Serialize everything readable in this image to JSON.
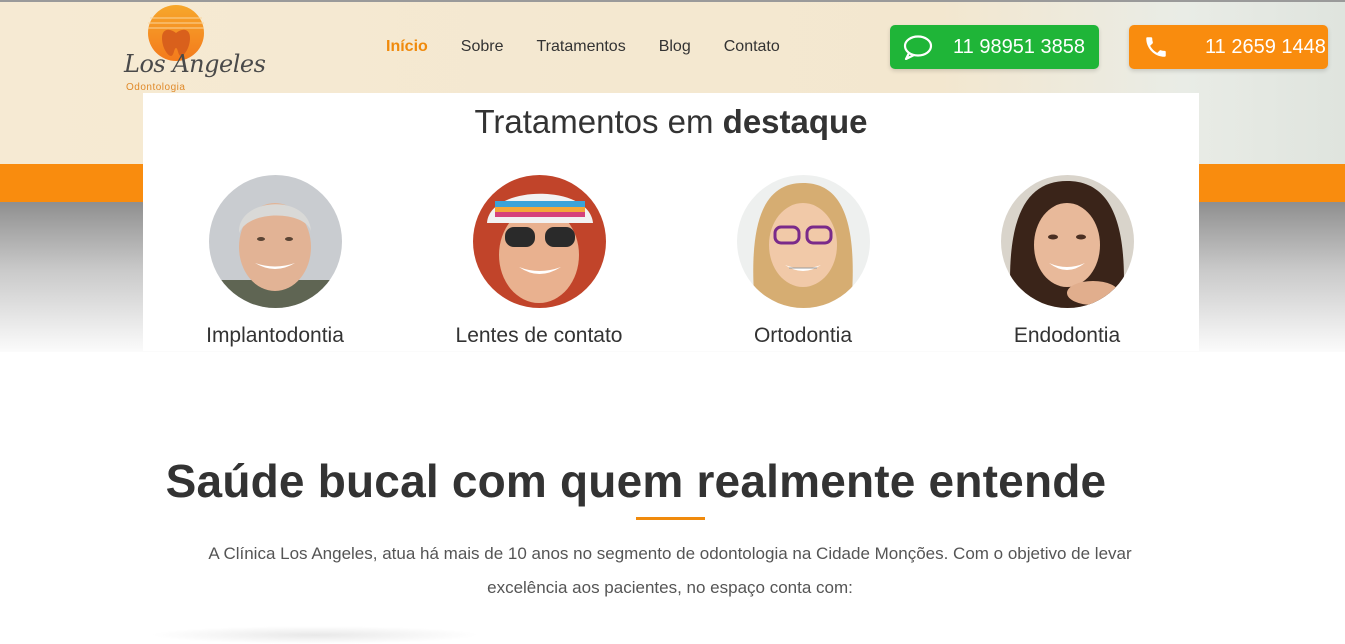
{
  "brand": {
    "logo_script": "Los Angeles",
    "logo_sub": "Odontologia",
    "accent": "#f98c0e"
  },
  "nav": {
    "items": [
      "Início",
      "Sobre",
      "Tratamentos",
      "Blog",
      "Contato"
    ],
    "active_index": 0
  },
  "contact": {
    "whatsapp": {
      "label": "11 98951 3858",
      "icon": "whatsapp-chat-icon",
      "color": "#1fb538"
    },
    "phone": {
      "label": "11 2659 1448",
      "icon": "phone-icon",
      "color": "#f98c0e"
    }
  },
  "featured": {
    "title_normal": "Tratamentos em ",
    "title_bold": "destaque",
    "treatments": [
      {
        "label": "Implantodontia",
        "image": "older-man-smiling-photo"
      },
      {
        "label": "Lentes de contato",
        "image": "woman-sunglasses-hat-photo"
      },
      {
        "label": "Ortodontia",
        "image": "girl-glasses-braces-photo"
      },
      {
        "label": "Endodontia",
        "image": "woman-smiling-hand-chin-photo"
      }
    ]
  },
  "about": {
    "title": "Saúde bucal com quem realmente entende",
    "text": "A Clínica Los Angeles, atua há mais de 10 anos no segmento de odontologia na Cidade Monções. Com o objetivo de levar excelência aos pacientes, no espaço conta com:"
  }
}
